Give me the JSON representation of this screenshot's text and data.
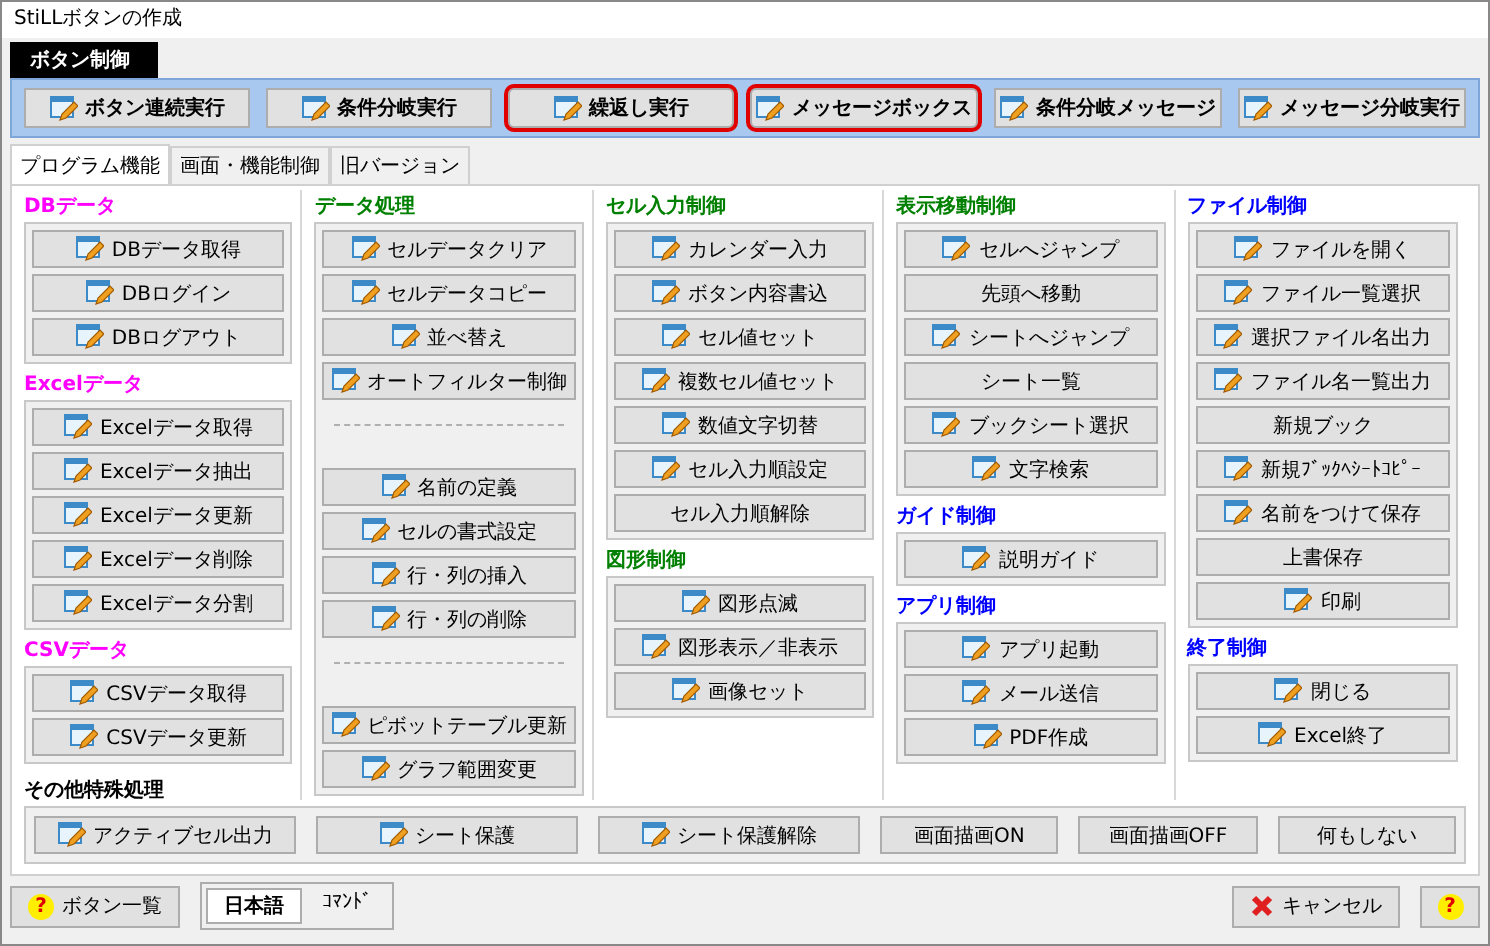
{
  "window": {
    "title": "StiLLボタンの作成"
  },
  "top_panel": {
    "label": "ボタン制御",
    "buttons": [
      {
        "label": "ボタン連続実行",
        "highlighted": false
      },
      {
        "label": "条件分岐実行",
        "highlighted": false
      },
      {
        "label": "繰返し実行",
        "highlighted": true
      },
      {
        "label": "メッセージボックス",
        "highlighted": true
      },
      {
        "label": "条件分岐メッセージ",
        "highlighted": false
      },
      {
        "label": "メッセージ分岐実行",
        "highlighted": false
      }
    ]
  },
  "tabs": [
    {
      "label": "プログラム機能",
      "selected": true
    },
    {
      "label": "画面・機能制御",
      "selected": false
    },
    {
      "label": "旧バージョン",
      "selected": false
    }
  ],
  "columns": [
    {
      "groups": [
        {
          "title": "DBデータ",
          "color": "#ff00ff",
          "items": [
            {
              "kind": "button",
              "label": "DBデータ取得",
              "icon": true
            },
            {
              "kind": "button",
              "label": "DBログイン",
              "icon": true
            },
            {
              "kind": "button",
              "label": "DBログアウト",
              "icon": true
            }
          ]
        },
        {
          "title": "Excelデータ",
          "color": "#ff00ff",
          "items": [
            {
              "kind": "button",
              "label": "Excelデータ取得",
              "icon": true
            },
            {
              "kind": "button",
              "label": "Excelデータ抽出",
              "icon": true
            },
            {
              "kind": "button",
              "label": "Excelデータ更新",
              "icon": true
            },
            {
              "kind": "button",
              "label": "Excelデータ削除",
              "icon": true
            },
            {
              "kind": "button",
              "label": "Excelデータ分割",
              "icon": true
            }
          ]
        },
        {
          "title": "CSVデータ",
          "color": "#ff00ff",
          "items": [
            {
              "kind": "button",
              "label": "CSVデータ取得",
              "icon": true
            },
            {
              "kind": "button",
              "label": "CSVデータ更新",
              "icon": true
            }
          ]
        }
      ]
    },
    {
      "groups": [
        {
          "title": "データ処理",
          "color": "#008000",
          "items": [
            {
              "kind": "button",
              "label": "セルデータクリア",
              "icon": true
            },
            {
              "kind": "button",
              "label": "セルデータコピー",
              "icon": true
            },
            {
              "kind": "button",
              "label": "並べ替え",
              "icon": true
            },
            {
              "kind": "button",
              "label": "オートフィルター制御",
              "icon": true
            },
            {
              "kind": "separator"
            },
            {
              "kind": "button",
              "label": "名前の定義",
              "icon": true
            },
            {
              "kind": "button",
              "label": "セルの書式設定",
              "icon": true
            },
            {
              "kind": "button",
              "label": "行・列の挿入",
              "icon": true
            },
            {
              "kind": "button",
              "label": "行・列の削除",
              "icon": true
            },
            {
              "kind": "separator"
            },
            {
              "kind": "button",
              "label": "ピボットテーブル更新",
              "icon": true
            },
            {
              "kind": "button",
              "label": "グラフ範囲変更",
              "icon": true
            }
          ]
        }
      ]
    },
    {
      "groups": [
        {
          "title": "セル入力制御",
          "color": "#008000",
          "items": [
            {
              "kind": "button",
              "label": "カレンダー入力",
              "icon": true
            },
            {
              "kind": "button",
              "label": "ボタン内容書込",
              "icon": true
            },
            {
              "kind": "button",
              "label": "セル値セット",
              "icon": true
            },
            {
              "kind": "button",
              "label": "複数セル値セット",
              "icon": true
            },
            {
              "kind": "button",
              "label": "数値文字切替",
              "icon": true
            },
            {
              "kind": "button",
              "label": "セル入力順設定",
              "icon": true
            },
            {
              "kind": "button",
              "label": "セル入力順解除",
              "icon": false
            }
          ]
        },
        {
          "title": "図形制御",
          "color": "#008000",
          "items": [
            {
              "kind": "button",
              "label": "図形点滅",
              "icon": true
            },
            {
              "kind": "button",
              "label": "図形表示／非表示",
              "icon": true
            },
            {
              "kind": "button",
              "label": "画像セット",
              "icon": true
            }
          ]
        }
      ]
    },
    {
      "groups": [
        {
          "title": "表示移動制御",
          "color": "#008000",
          "items": [
            {
              "kind": "button",
              "label": "セルへジャンプ",
              "icon": true
            },
            {
              "kind": "button",
              "label": "先頭へ移動",
              "icon": false
            },
            {
              "kind": "button",
              "label": "シートへジャンプ",
              "icon": true
            },
            {
              "kind": "button",
              "label": "シート一覧",
              "icon": false
            },
            {
              "kind": "button",
              "label": "ブックシート選択",
              "icon": true
            },
            {
              "kind": "button",
              "label": "文字検索",
              "icon": true
            }
          ]
        },
        {
          "title": "ガイド制御",
          "color": "#0000ff",
          "items": [
            {
              "kind": "button",
              "label": "説明ガイド",
              "icon": true
            }
          ]
        },
        {
          "title": "アプリ制御",
          "color": "#0000ff",
          "items": [
            {
              "kind": "button",
              "label": "アプリ起動",
              "icon": true
            },
            {
              "kind": "button",
              "label": "メール送信",
              "icon": true
            },
            {
              "kind": "button",
              "label": "PDF作成",
              "icon": true
            }
          ]
        }
      ]
    },
    {
      "groups": [
        {
          "title": "ファイル制御",
          "color": "#0000ff",
          "items": [
            {
              "kind": "button",
              "label": "ファイルを開く",
              "icon": true
            },
            {
              "kind": "button",
              "label": "ファイル一覧選択",
              "icon": true
            },
            {
              "kind": "button",
              "label": "選択ファイル名出力",
              "icon": true
            },
            {
              "kind": "button",
              "label": "ファイル名一覧出力",
              "icon": true
            },
            {
              "kind": "button",
              "label": "新規ブック",
              "icon": false
            },
            {
              "kind": "button",
              "label": "新規ﾌﾞｯｸﾍｼｰﾄｺﾋﾟｰ",
              "icon": true
            },
            {
              "kind": "button",
              "label": "名前をつけて保存",
              "icon": true
            },
            {
              "kind": "button",
              "label": "上書保存",
              "icon": false
            },
            {
              "kind": "button",
              "label": "印刷",
              "icon": true
            }
          ]
        },
        {
          "title": "終了制御",
          "color": "#0000ff",
          "items": [
            {
              "kind": "button",
              "label": "閉じる",
              "icon": true
            },
            {
              "kind": "button",
              "label": "Excel終了",
              "icon": true
            }
          ]
        }
      ]
    }
  ],
  "other": {
    "title": "その他特殊処理",
    "color": "#000000",
    "buttons": [
      {
        "label": "アクティブセル出力",
        "icon": true
      },
      {
        "label": "シート保護",
        "icon": true
      },
      {
        "label": "シート保護解除",
        "icon": true
      },
      {
        "label": "画面描画ON",
        "icon": false
      },
      {
        "label": "画面描画OFF",
        "icon": false
      },
      {
        "label": "何もしない",
        "icon": false
      }
    ]
  },
  "footer": {
    "list_button": {
      "label": "ボタン一覧",
      "icon_text": "?"
    },
    "language_toggle": [
      {
        "label": "日本語",
        "selected": true
      },
      {
        "label": "ｺﾏﾝﾄﾞ",
        "selected": false
      }
    ],
    "cancel_button": {
      "label": "キャンセル"
    },
    "help_button": {
      "icon_text": "?"
    }
  }
}
